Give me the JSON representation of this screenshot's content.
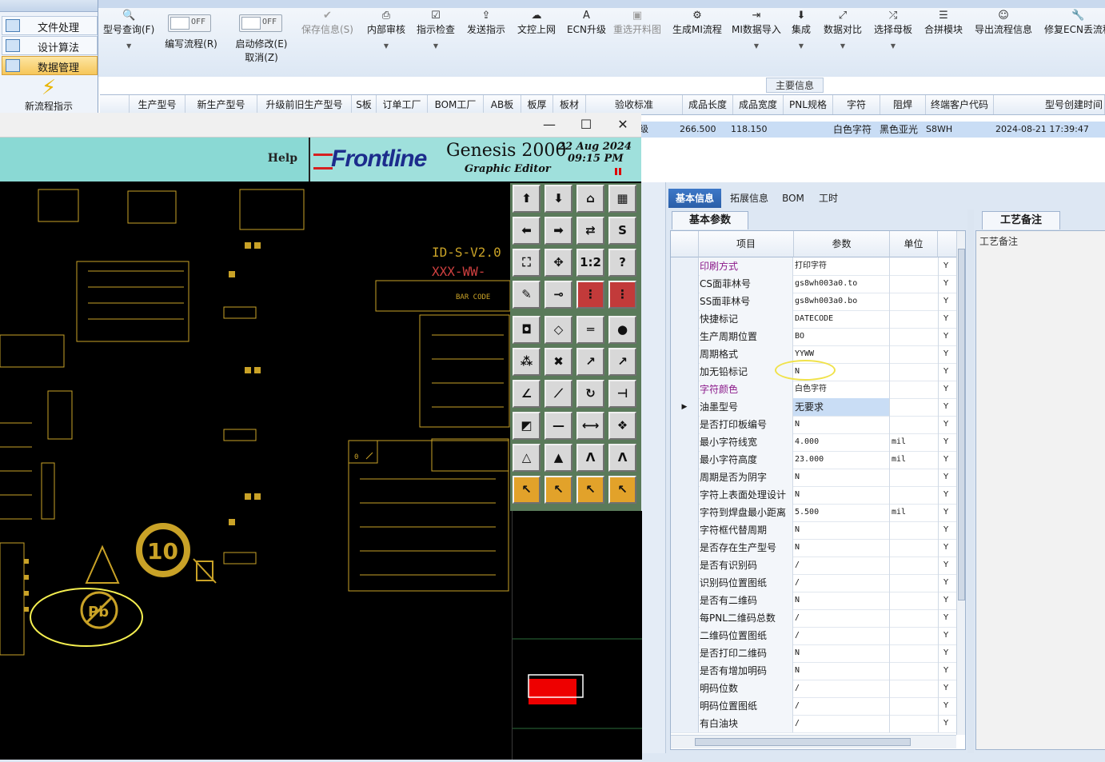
{
  "nav": {
    "items": [
      {
        "label": "文件处理",
        "active": false
      },
      {
        "label": "设计算法",
        "active": false
      },
      {
        "label": "数据管理",
        "active": true
      }
    ],
    "new_flow": "新流程指示"
  },
  "ribbon": {
    "buttons": [
      {
        "label": "型号查询(F)",
        "icon": "search-icon",
        "disabled": false,
        "dropdown": true
      },
      {
        "label": "保存信息(S)",
        "icon": "check-icon",
        "disabled": true,
        "dropdown": false
      },
      {
        "label": "内部审核",
        "icon": "printer-icon",
        "disabled": false,
        "dropdown": true
      },
      {
        "label": "指示检查",
        "icon": "checkbox-icon",
        "disabled": false,
        "dropdown": true
      },
      {
        "label": "发送指示",
        "icon": "upload-icon",
        "disabled": false,
        "dropdown": false
      },
      {
        "label": "文控上网",
        "icon": "cloud-upload-icon",
        "disabled": false,
        "dropdown": false
      },
      {
        "label": "ECN升级",
        "icon": "letter-a-icon",
        "disabled": false,
        "dropdown": false
      },
      {
        "label": "重选开料图",
        "icon": "image-icon",
        "disabled": true,
        "dropdown": false
      },
      {
        "label": "生成MI流程",
        "icon": "gears-icon",
        "disabled": false,
        "dropdown": false
      },
      {
        "label": "MI数据导入",
        "icon": "import-icon",
        "disabled": false,
        "dropdown": true
      },
      {
        "label": "集成",
        "icon": "download-icon",
        "disabled": false,
        "dropdown": true
      },
      {
        "label": "数据对比",
        "icon": "compare-icon",
        "disabled": false,
        "dropdown": true
      },
      {
        "label": "选择母板",
        "icon": "shuffle-icon",
        "disabled": false,
        "dropdown": true
      },
      {
        "label": "合拼模块",
        "icon": "list-icon",
        "disabled": false,
        "dropdown": false
      },
      {
        "label": "导出流程信息",
        "icon": "smile-icon",
        "disabled": false,
        "dropdown": false
      },
      {
        "label": "修复ECN丢流程",
        "icon": "wrench-icon",
        "disabled": false,
        "dropdown": false
      }
    ],
    "toggles": [
      {
        "state": "OFF",
        "label": "编写流程(R)"
      },
      {
        "state": "OFF",
        "label": "启动修改(E)",
        "label2": "取消(Z)"
      }
    ]
  },
  "grid": {
    "section_title": "主要信息",
    "columns": [
      "生产型号",
      "新生产型号",
      "升级前旧生产型号",
      "S板",
      "订单工厂",
      "BOM工厂",
      "AB板",
      "板厚",
      "板材",
      "验收标准",
      "成品长度",
      "成品宽度",
      "PNL规格",
      "字符",
      "阻焊",
      "终端客户代码",
      "型号创建时间"
    ],
    "row": {
      "acceptance_tail": "级",
      "length": "266.500",
      "width": "118.150",
      "silkscreen": "白色字符",
      "soldermask": "黑色亚光",
      "customer_code": "S8WH",
      "created": "2024-08-21 17:39:47"
    }
  },
  "genesis": {
    "help": "Help",
    "brand": "Frontline",
    "product": "Genesis 2000",
    "subtitle": "Graphic Editor",
    "date": "22 Aug 2024",
    "time": "09:15 PM",
    "win_min": "—",
    "win_max": "☐",
    "win_close": "✕",
    "pcb_labels": {
      "version": "ID-S-V2.0",
      "code": "XXX-WW-",
      "barcode": "BAR CODE",
      "rohs": "10"
    },
    "tool_text": {
      "zoom": "1:2",
      "help": "?"
    }
  },
  "detail": {
    "tabs": [
      "基本信息",
      "拓展信息",
      "BOM",
      "工时"
    ],
    "active_tab": "基本信息",
    "subtab": "基本参数",
    "headers": [
      "项目",
      "参数",
      "单位"
    ],
    "rows": [
      {
        "item": "印刷方式",
        "value": "打印字符",
        "unit": "",
        "flag": "Y",
        "accent": true
      },
      {
        "item": "CS面菲林号",
        "value": "gs8wh003a0.to",
        "unit": "",
        "flag": "Y"
      },
      {
        "item": "SS面菲林号",
        "value": "gs8wh003a0.bo",
        "unit": "",
        "flag": "Y"
      },
      {
        "item": "快捷标记",
        "value": "DATECODE",
        "unit": "",
        "flag": "Y"
      },
      {
        "item": "生产周期位置",
        "value": "BO",
        "unit": "",
        "flag": "Y"
      },
      {
        "item": "周期格式",
        "value": "YYWW",
        "unit": "",
        "flag": "Y"
      },
      {
        "item": "加无铅标记",
        "value": "N",
        "unit": "",
        "flag": "Y",
        "circled": true
      },
      {
        "item": "字符颜色",
        "value": "白色字符",
        "unit": "",
        "flag": "Y",
        "accent": true
      },
      {
        "item": "油墨型号",
        "value": "无要求",
        "unit": "",
        "flag": "Y",
        "selected": true
      },
      {
        "item": "是否打印板编号",
        "value": "N",
        "unit": "",
        "flag": "Y"
      },
      {
        "item": "最小字符线宽",
        "value": "4.000",
        "unit": "mil",
        "flag": "Y"
      },
      {
        "item": "最小字符高度",
        "value": "23.000",
        "unit": "mil",
        "flag": "Y"
      },
      {
        "item": "周期是否为阴字",
        "value": "N",
        "unit": "",
        "flag": "Y"
      },
      {
        "item": "字符上表面处理设计",
        "value": "N",
        "unit": "",
        "flag": "Y"
      },
      {
        "item": "字符到焊盘最小距离",
        "value": "5.500",
        "unit": "mil",
        "flag": "Y"
      },
      {
        "item": "字符框代替周期",
        "value": "N",
        "unit": "",
        "flag": "Y"
      },
      {
        "item": "是否存在生产型号",
        "value": "N",
        "unit": "",
        "flag": "Y"
      },
      {
        "item": "是否有识别码",
        "value": "/",
        "unit": "",
        "flag": "Y"
      },
      {
        "item": "识别码位置图纸",
        "value": "/",
        "unit": "",
        "flag": "Y"
      },
      {
        "item": "是否有二维码",
        "value": "N",
        "unit": "",
        "flag": "Y"
      },
      {
        "item": "每PNL二维码总数",
        "value": "/",
        "unit": "",
        "flag": "Y"
      },
      {
        "item": "二维码位置图纸",
        "value": "/",
        "unit": "",
        "flag": "Y"
      },
      {
        "item": "是否打印二维码",
        "value": "N",
        "unit": "",
        "flag": "Y"
      },
      {
        "item": "是否有增加明码",
        "value": "N",
        "unit": "",
        "flag": "Y"
      },
      {
        "item": "明码位数",
        "value": "/",
        "unit": "",
        "flag": "Y"
      },
      {
        "item": "明码位置图纸",
        "value": "/",
        "unit": "",
        "flag": "Y"
      },
      {
        "item": "有白油块",
        "value": "/",
        "unit": "",
        "flag": "Y"
      }
    ],
    "notes_tab": "工艺备注",
    "notes_header": "工艺备注"
  }
}
